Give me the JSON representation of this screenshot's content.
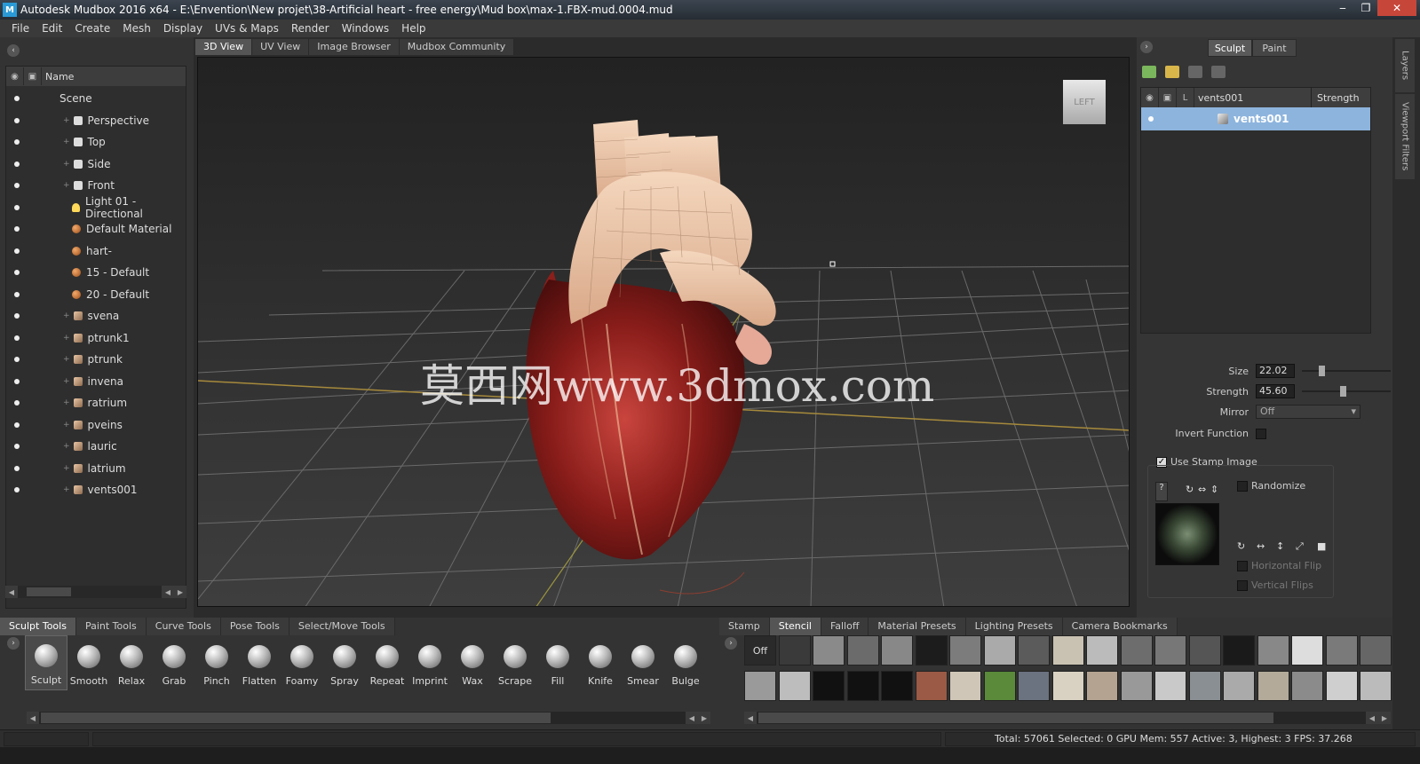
{
  "window": {
    "title": "Autodesk Mudbox 2016 x64 - E:\\Envention\\New projet\\38-Artificial heart - free energy\\Mud box\\max-1.FBX-mud.0004.mud",
    "buttons": [
      "‒",
      "❐",
      "✕"
    ]
  },
  "menu": [
    "File",
    "Edit",
    "Create",
    "Mesh",
    "Display",
    "UVs & Maps",
    "Render",
    "Windows",
    "Help"
  ],
  "outliner": {
    "header": "Name",
    "items": [
      {
        "label": "Scene",
        "icon": "none",
        "indent": 0
      },
      {
        "label": "Perspective",
        "icon": "camera-icon",
        "indent": 1
      },
      {
        "label": "Top",
        "icon": "camera-icon",
        "indent": 1
      },
      {
        "label": "Side",
        "icon": "camera-icon",
        "indent": 1
      },
      {
        "label": "Front",
        "icon": "camera-icon",
        "indent": 1
      },
      {
        "label": "Light 01 - Directional",
        "icon": "light-icon",
        "indent": 2
      },
      {
        "label": "Default Material",
        "icon": "material-icon",
        "indent": 2
      },
      {
        "label": "hart-",
        "icon": "material-icon",
        "indent": 2
      },
      {
        "label": "15 - Default",
        "icon": "material-icon",
        "indent": 2
      },
      {
        "label": "20 - Default",
        "icon": "material-icon",
        "indent": 2
      },
      {
        "label": "svena",
        "icon": "mesh-icon",
        "indent": 1
      },
      {
        "label": "ptrunk1",
        "icon": "mesh-icon",
        "indent": 1
      },
      {
        "label": "ptrunk",
        "icon": "mesh-icon",
        "indent": 1
      },
      {
        "label": "invena",
        "icon": "mesh-icon",
        "indent": 1
      },
      {
        "label": "ratrium",
        "icon": "mesh-icon",
        "indent": 1
      },
      {
        "label": "pveins",
        "icon": "mesh-icon",
        "indent": 1
      },
      {
        "label": "lauric",
        "icon": "mesh-icon",
        "indent": 1
      },
      {
        "label": "latrium",
        "icon": "mesh-icon",
        "indent": 1
      },
      {
        "label": "vents001",
        "icon": "mesh-icon",
        "indent": 1
      }
    ]
  },
  "view_tabs": [
    "3D View",
    "UV View",
    "Image Browser",
    "Mudbox Community"
  ],
  "viewport": {
    "viewcube_label": "LEFT",
    "watermark": "莫西网www.3dmox.com"
  },
  "right_panel": {
    "mode_tabs": [
      "Sculpt",
      "Paint"
    ],
    "layers_header": {
      "lock": "L",
      "name": "vents001",
      "strength": "Strength"
    },
    "layer": "vents001",
    "side_tabs": [
      "Layers",
      "Viewport Filters"
    ],
    "props": {
      "size_label": "Size",
      "size_value": "22.02",
      "size_fraction": 0.22,
      "strength_label": "Strength",
      "strength_value": "45.60",
      "strength_fraction": 0.46,
      "mirror_label": "Mirror",
      "mirror_value": "Off",
      "invert_label": "Invert Function",
      "use_stamp_label": "Use Stamp Image",
      "randomize_label": "Randomize",
      "hflip_label": "Horizontal Flip",
      "vflip_label": "Vertical Flips"
    }
  },
  "tool_tabs": [
    "Sculpt Tools",
    "Paint Tools",
    "Curve Tools",
    "Pose Tools",
    "Select/Move Tools"
  ],
  "tools": [
    "Sculpt",
    "Smooth",
    "Relax",
    "Grab",
    "Pinch",
    "Flatten",
    "Foamy",
    "Spray",
    "Repeat",
    "Imprint",
    "Wax",
    "Scrape",
    "Fill",
    "Knife",
    "Smear",
    "Bulge"
  ],
  "stamp_tabs": [
    "Stamp",
    "Stencil",
    "Falloff",
    "Material Presets",
    "Lighting Presets",
    "Camera Bookmarks"
  ],
  "stamp_off_label": "Off",
  "status": "Total: 57061  Selected: 0 GPU Mem: 557  Active: 3, Highest: 3  FPS: 37.268"
}
